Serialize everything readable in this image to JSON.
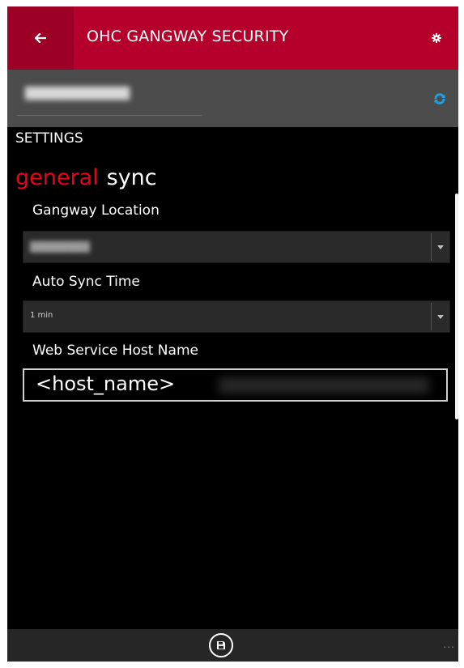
{
  "header": {
    "title": "OHC GANGWAY SECURITY",
    "back_icon": "arrow-left-icon",
    "settings_icon": "gear-icon",
    "accent_color": "#b5002c",
    "back_color": "#9c0024"
  },
  "subbar": {
    "sync_icon": "refresh-icon",
    "sync_color": "#1ba1e2"
  },
  "settings": {
    "label": "SETTINGS",
    "pivot": {
      "active": "general",
      "inactive": "sync",
      "active_color": "#e8001c"
    },
    "fields": {
      "gangway_location": {
        "label": "Gangway Location"
      },
      "auto_sync_time": {
        "label": "Auto Sync Time",
        "value": "1 min"
      },
      "web_service_host": {
        "label": "Web Service Host Name",
        "value": "<host_name>"
      }
    }
  },
  "appbar": {
    "save_icon": "save-icon",
    "more_label": "..."
  }
}
